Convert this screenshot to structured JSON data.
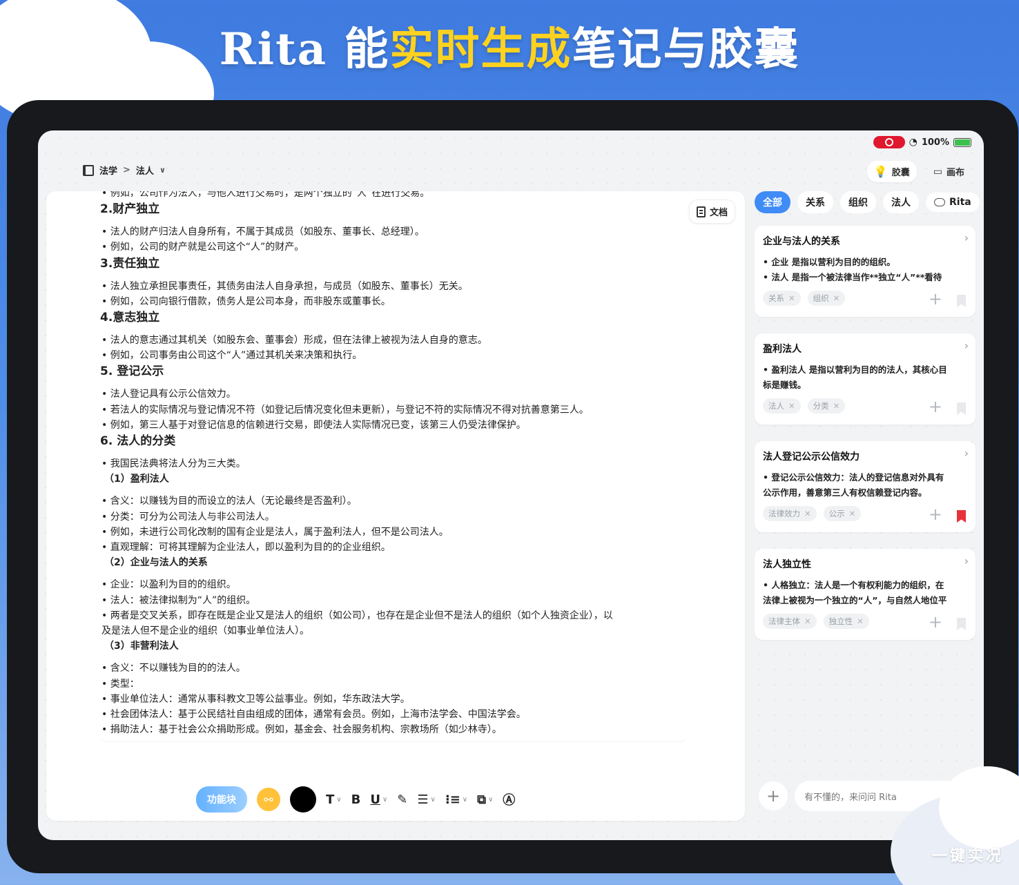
{
  "banner": {
    "part1": "Rita 能",
    "part2": "实时生成",
    "part3": "笔记与胶囊"
  },
  "status": {
    "battery": "100%"
  },
  "breadcrumb": {
    "root": "法学",
    "sep": ">",
    "current": "法人"
  },
  "top_actions": {
    "capsule": "胶囊",
    "canvas": "画布"
  },
  "doc": {
    "button": "文档",
    "lines": [
      {
        "t": "• 例如，公司作为法人，与他人进行交易时，是两个独立的“人”在进行交易。",
        "k": "bul"
      },
      {
        "t": "2.财产独立",
        "k": "h"
      },
      {
        "t": "",
        "k": "gap"
      },
      {
        "t": "• 法人的财产归法人自身所有，不属于其成员（如股东、董事长、总经理）。",
        "k": "bul"
      },
      {
        "t": "• 例如，公司的财产就是公司这个“人”的财产。",
        "k": "bul"
      },
      {
        "t": "3.责任独立",
        "k": "h"
      },
      {
        "t": "",
        "k": "gap"
      },
      {
        "t": "• 法人独立承担民事责任，其债务由法人自身承担，与成员（如股东、董事长）无关。",
        "k": "bul"
      },
      {
        "t": "• 例如，公司向银行借款，债务人是公司本身，而非股东或董事长。",
        "k": "bul"
      },
      {
        "t": "4.意志独立",
        "k": "h"
      },
      {
        "t": "",
        "k": "gap"
      },
      {
        "t": "• 法人的意志通过其机关（如股东会、董事会）形成，但在法律上被视为法人自身的意志。",
        "k": "bul"
      },
      {
        "t": "• 例如，公司事务由公司这个“人”通过其机关来决策和执行。",
        "k": "bul"
      },
      {
        "t": "5. 登记公示",
        "k": "h"
      },
      {
        "t": "",
        "k": "gap"
      },
      {
        "t": "• 法人登记具有公示公信效力。",
        "k": "bul"
      },
      {
        "t": "• 若法人的实际情况与登记情况不符（如登记后情况变化但未更新），与登记不符的实际情况不得对抗善意第三人。",
        "k": "bul"
      },
      {
        "t": "• 例如，第三人基于对登记信息的信赖进行交易，即使法人实际情况已变，该第三人仍受法律保护。",
        "k": "bul"
      },
      {
        "t": "6. 法人的分类",
        "k": "h"
      },
      {
        "t": "",
        "k": "gap"
      },
      {
        "t": "• 我国民法典将法人分为三大类。",
        "k": "bul"
      },
      {
        "t": "（1）盈利法人",
        "k": "sub"
      },
      {
        "t": "",
        "k": "gap"
      },
      {
        "t": "• 含义：以赚钱为目的而设立的法人（无论最终是否盈利）。",
        "k": "bul"
      },
      {
        "t": "• 分类：可分为公司法人与非公司法人。",
        "k": "bul"
      },
      {
        "t": "• 例如，未进行公司化改制的国有企业是法人，属于盈利法人，但不是公司法人。",
        "k": "bul"
      },
      {
        "t": "• 直观理解：可将其理解为企业法人，即以盈利为目的的企业组织。",
        "k": "bul"
      },
      {
        "t": "（2）企业与法人的关系",
        "k": "sub"
      },
      {
        "t": "",
        "k": "gap"
      },
      {
        "t": "• 企业：以盈利为目的的组织。",
        "k": "bul"
      },
      {
        "t": "• 法人：被法律拟制为“人”的组织。",
        "k": "bul"
      },
      {
        "t": "• 两者是交叉关系，即存在既是企业又是法人的组织（如公司），也存在是企业但不是法人的组织（如个人独资企业），以",
        "k": "bul"
      },
      {
        "t": "及是法人但不是企业的组织（如事业单位法人）。",
        "k": "bul"
      },
      {
        "t": "（3）非营利法人",
        "k": "sub"
      },
      {
        "t": "",
        "k": "gap"
      },
      {
        "t": "• 含义：不以赚钱为目的的法人。",
        "k": "bul"
      },
      {
        "t": "• 类型：",
        "k": "bul"
      },
      {
        "t": "• 事业单位法人：通常从事科教文卫等公益事业。例如，华东政法大学。",
        "k": "bul"
      },
      {
        "t": "• 社会团体法人：基于公民结社自由组成的团体，通常有会员。例如，上海市法学会、中国法学会。",
        "k": "bul"
      },
      {
        "t": "• 捐助法人：基于社会公众捐助形成。例如，基金会、社会服务机构、宗教场所（如少林寺）。",
        "k": "bul"
      }
    ]
  },
  "toolbar": {
    "function_block": "功能块"
  },
  "filters": [
    "全部",
    "关系",
    "组织",
    "法人"
  ],
  "filter_rita": "Rita",
  "cards": [
    {
      "title": "企业与法人的关系",
      "body": [
        "• 企业 是指以营利为目的的组织。",
        "• 法人 是指一个被法律当作**独立“人”**看待"
      ],
      "tags": [
        "关系",
        "组织"
      ],
      "bookmarked": false
    },
    {
      "title": "盈利法人",
      "body": [
        "• 盈利法人 是指以营利为目的的法人，其核心目",
        "标是赚钱。"
      ],
      "tags": [
        "法人",
        "分类"
      ],
      "bookmarked": false
    },
    {
      "title": "法人登记公示公信效力",
      "body": [
        "• 登记公示公信效力：法人的登记信息对外具有",
        "公示作用，善意第三人有权信赖登记内容。"
      ],
      "tags": [
        "法律效力",
        "公示"
      ],
      "bookmarked": true
    },
    {
      "title": "法人独立性",
      "body": [
        "• 人格独立：法人是一个有权利能力的组织，在",
        "法律上被视为一个独立的“人”，与自然人地位平"
      ],
      "tags": [
        "法律主体",
        "独立性"
      ],
      "bookmarked": false
    }
  ],
  "ask": {
    "placeholder": "有不懂的，来问问 Rita"
  },
  "watermark": "一键实况"
}
